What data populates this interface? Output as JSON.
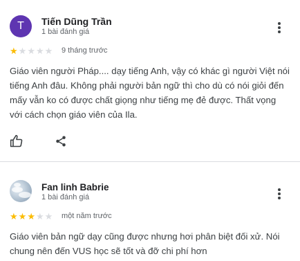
{
  "reviews": [
    {
      "author": "Tiến Dũng Trần",
      "avatar_letter": "T",
      "avatar_color": "#5e35b1",
      "review_count": "1 bài đánh giá",
      "rating": 1,
      "rating_max": 5,
      "date": "9 tháng trước",
      "text": "Giáo viên người Pháp.... dạy tiếng Anh, vậy có khác gì người Việt nói tiếng Anh đâu. Không phải người bản ngữ thì cho dù có nói giỏi đến mấy vẫn ko có được chất giọng như tiếng mẹ đẻ được. Thất vọng với cách chọn giáo viên của Ila.",
      "actions": {
        "like_icon": "thumbs-up-icon",
        "share_icon": "share-icon"
      }
    },
    {
      "author": "Fan linh Babrie",
      "avatar_type": "photo",
      "review_count": "1 bài đánh giá",
      "rating": 3,
      "rating_max": 5,
      "date": "một năm trước",
      "text": "Giáo viên bản ngữ dạy cũng được nhưng hơi phân biệt đối xử. Nói chung nên đến VUS học sẽ tốt và đỡ chi phí hơn"
    }
  ],
  "colors": {
    "star_on": "#fbbc04",
    "star_off": "#dadce0",
    "divider": "#dadce0"
  }
}
